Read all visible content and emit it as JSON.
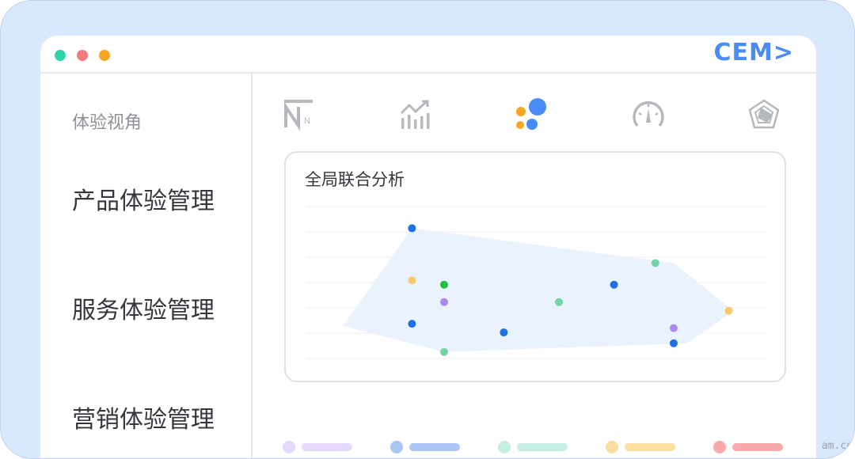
{
  "window": {
    "brand": "CEM>",
    "controls": [
      {
        "name": "close",
        "color": "#2dd4a7"
      },
      {
        "name": "minimize",
        "color": "#f47c7c"
      },
      {
        "name": "maximize",
        "color": "#f5a623"
      }
    ]
  },
  "sidebar": {
    "heading": "体验视角",
    "items": [
      {
        "label": "产品体验管理"
      },
      {
        "label": "服务体验管理"
      },
      {
        "label": "营销体验管理"
      }
    ]
  },
  "tabs": [
    {
      "icon": "nps-icon",
      "active": false
    },
    {
      "icon": "trend-chart-icon",
      "active": false
    },
    {
      "icon": "bubble-cluster-icon",
      "active": true
    },
    {
      "icon": "gauge-icon",
      "active": false
    },
    {
      "icon": "radar-icon",
      "active": false
    }
  ],
  "colors": {
    "accent": "#4a8cf7",
    "icon_inactive": "#b5b8bd",
    "area_fill": "#e8f1fd"
  },
  "chart": {
    "title": "全局联合分析",
    "chart_data": {
      "type": "scatter",
      "grid": true,
      "gridlines": 7,
      "xlim": [
        0,
        10
      ],
      "ylim": [
        0,
        7
      ],
      "hull": [
        [
          0.8,
          1.5
        ],
        [
          2.3,
          6.0
        ],
        [
          8.0,
          4.4
        ],
        [
          9.3,
          2.2
        ],
        [
          8.3,
          0.7
        ],
        [
          3.0,
          0.3
        ]
      ],
      "points": [
        {
          "x": 2.3,
          "y": 6.0,
          "color": "#1f6fe8"
        },
        {
          "x": 2.3,
          "y": 3.6,
          "color": "#fbc76a"
        },
        {
          "x": 3.0,
          "y": 3.4,
          "color": "#22c145"
        },
        {
          "x": 3.0,
          "y": 2.6,
          "color": "#ae88f0"
        },
        {
          "x": 2.3,
          "y": 1.6,
          "color": "#1f6fe8"
        },
        {
          "x": 3.0,
          "y": 0.3,
          "color": "#6fd6a6"
        },
        {
          "x": 4.3,
          "y": 1.2,
          "color": "#1f6fe8"
        },
        {
          "x": 5.5,
          "y": 2.6,
          "color": "#6fd6a6"
        },
        {
          "x": 6.7,
          "y": 3.4,
          "color": "#1f6fe8"
        },
        {
          "x": 7.6,
          "y": 4.4,
          "color": "#6fd6a6"
        },
        {
          "x": 8.0,
          "y": 1.4,
          "color": "#ae88f0"
        },
        {
          "x": 8.0,
          "y": 0.7,
          "color": "#1f6fe8"
        },
        {
          "x": 9.2,
          "y": 2.2,
          "color": "#fbc76a"
        }
      ]
    }
  },
  "legend": [
    {
      "dot": "#e5d8fb",
      "bar": "#e5d8fb"
    },
    {
      "dot": "#aac6f5",
      "bar": "#aac6f5"
    },
    {
      "dot": "#c5ede4",
      "bar": "#c5ede4"
    },
    {
      "dot": "#fcdfa0",
      "bar": "#fcdfa0"
    },
    {
      "dot": "#f8aaaa",
      "bar": "#f8aaaa"
    }
  ],
  "watermark": "am.co"
}
